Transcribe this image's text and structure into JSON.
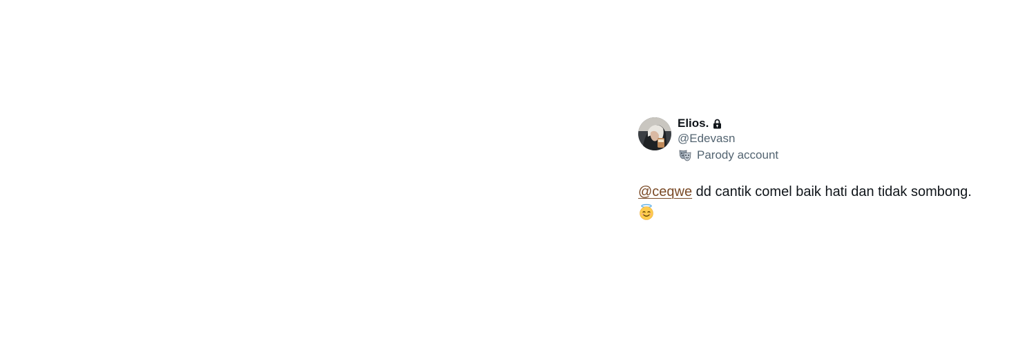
{
  "user": {
    "display_name": "Elios.",
    "handle": "@Edevasn",
    "label": "Parody account",
    "protected_icon": "lock-icon",
    "label_icon": "performing-arts-masks-icon"
  },
  "tweet": {
    "mention": "@ceqwe",
    "text": " dd cantik comel baik hati dan tidak sombong.",
    "emoji": "smiling-face-with-halo-emoji"
  },
  "colors": {
    "primary_text": "#0f1419",
    "secondary_text": "#536471",
    "mention": "#7a4a26",
    "background": "#ffffff"
  }
}
